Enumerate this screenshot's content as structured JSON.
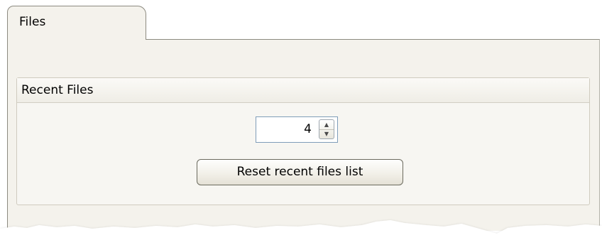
{
  "tabs": [
    {
      "label": "Files",
      "selected": true
    }
  ],
  "group": {
    "title": "Recent Files"
  },
  "recent_files": {
    "count_value": "4",
    "spin_up_glyph": "▲",
    "spin_down_glyph": "▼",
    "reset_button_label": "Reset recent files list"
  },
  "colors": {
    "panel_bg": "#f4f2ec",
    "input_border": "#7f9db9",
    "button_border": "#6b6a5e"
  }
}
